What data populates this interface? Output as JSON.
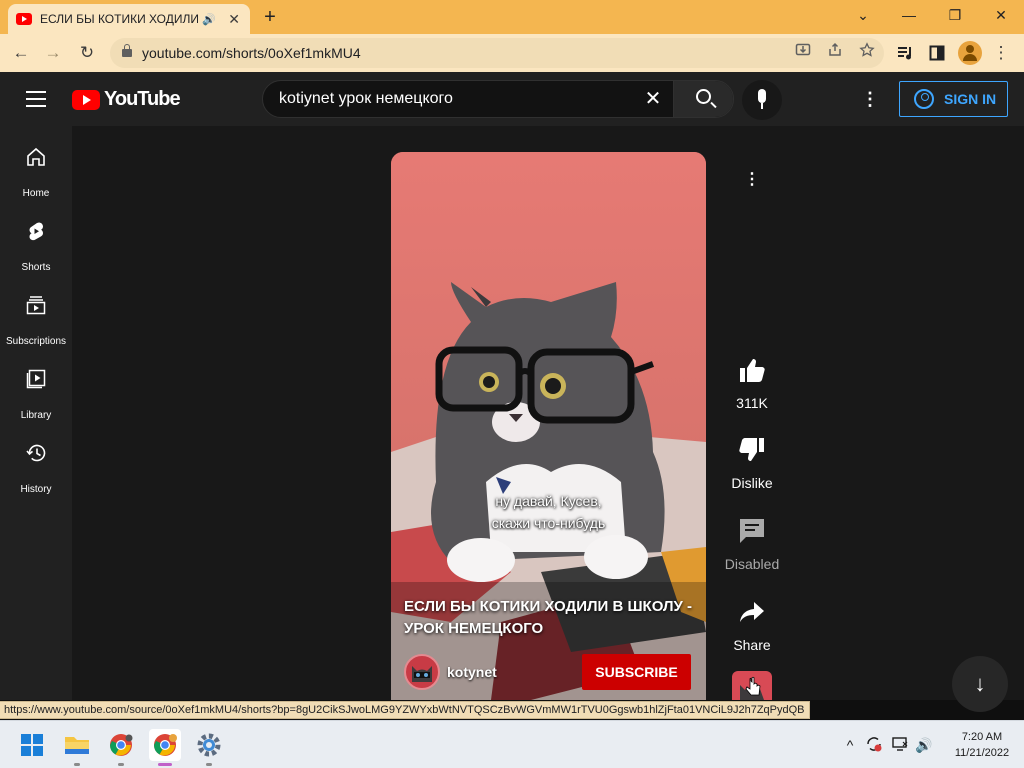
{
  "browser": {
    "tab_title": "ЕСЛИ БЫ КОТИКИ ХОДИЛИ",
    "audio_icon": "🔊",
    "tab_close": "✕",
    "new_tab": "+",
    "url": "youtube.com/shorts/0oXef1mkMU4",
    "status_url": "https://www.youtube.com/source/0oXef1mkMU4/shorts?bp=8gU2CikSJwoLMG9YZWYxbWtNVTQSCzBvWGVmMW1rTVU0Ggswb1hlZjFta01VNCiL9J2h7ZqPydQB",
    "window": {
      "minimize": "—",
      "restore": "❐",
      "close": "✕",
      "dropdown": "⌄"
    },
    "nav": {
      "back": "←",
      "forward": "→",
      "reload": "↻",
      "more": "⋮"
    },
    "colors": {
      "tabstrip": "#f4b650",
      "toolbar": "#fbe6c0"
    }
  },
  "youtube": {
    "logo_text": "YouTube",
    "search_value": "kotiynet урок немецкого",
    "clear": "✕",
    "more": "⋮",
    "sign_in": "SIGN IN",
    "sidebar": [
      {
        "label": "Home",
        "icon": "home-icon"
      },
      {
        "label": "Shorts",
        "icon": "shorts-icon"
      },
      {
        "label": "Subscriptions",
        "icon": "subscriptions-icon"
      },
      {
        "label": "Library",
        "icon": "library-icon"
      },
      {
        "label": "History",
        "icon": "history-icon"
      }
    ],
    "short": {
      "caption_line1": "ну давай, Кусев,",
      "caption_line2": "скажи что-нибудь",
      "title": "ЕСЛИ БЫ КОТИКИ ХОДИЛИ В ШКОЛУ - УРОК НЕМЕЦКОГО",
      "channel": "kotynet",
      "subscribe": "SUBSCRIBE",
      "menu": "⋮"
    },
    "actions": {
      "likes": "311K",
      "dislike": "Dislike",
      "comments": "Disabled",
      "share": "Share"
    },
    "scroll_down": "↓",
    "colors": {
      "accent": "#3ea6ff",
      "brand": "#ff0000",
      "subscribe": "#cc0000"
    }
  },
  "taskbar": {
    "time": "7:20 AM",
    "date": "11/21/2022",
    "tray_chevron": "^",
    "volume": "🔊"
  }
}
